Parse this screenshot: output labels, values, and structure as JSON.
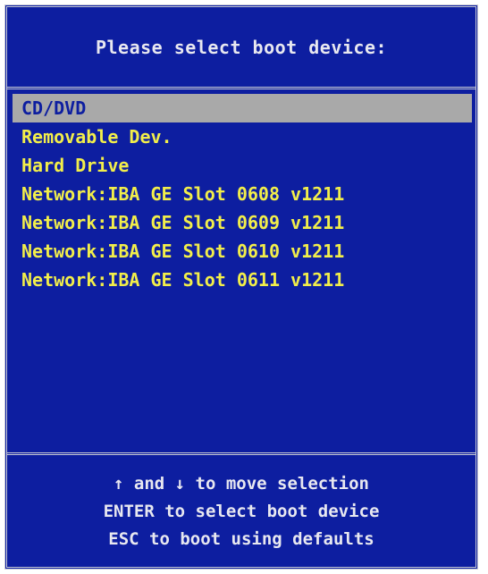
{
  "header": {
    "title": "Please select boot device:"
  },
  "devices": [
    {
      "label": "CD/DVD",
      "selected": true
    },
    {
      "label": "Removable Dev.",
      "selected": false
    },
    {
      "label": "Hard Drive",
      "selected": false
    },
    {
      "label": "Network:IBA GE Slot 0608 v1211",
      "selected": false
    },
    {
      "label": "Network:IBA GE Slot 0609 v1211",
      "selected": false
    },
    {
      "label": "Network:IBA GE Slot 0610 v1211",
      "selected": false
    },
    {
      "label": "Network:IBA GE Slot 0611 v1211",
      "selected": false
    }
  ],
  "footer": {
    "help_lines": [
      "↑ and ↓ to move selection",
      "ENTER to select boot device",
      "ESC to boot using defaults"
    ]
  },
  "colors": {
    "background": "#0d1ea0",
    "item_text": "#f2ee4a",
    "selection_bar": "#a9a9a9",
    "border": "#c8cad4"
  }
}
